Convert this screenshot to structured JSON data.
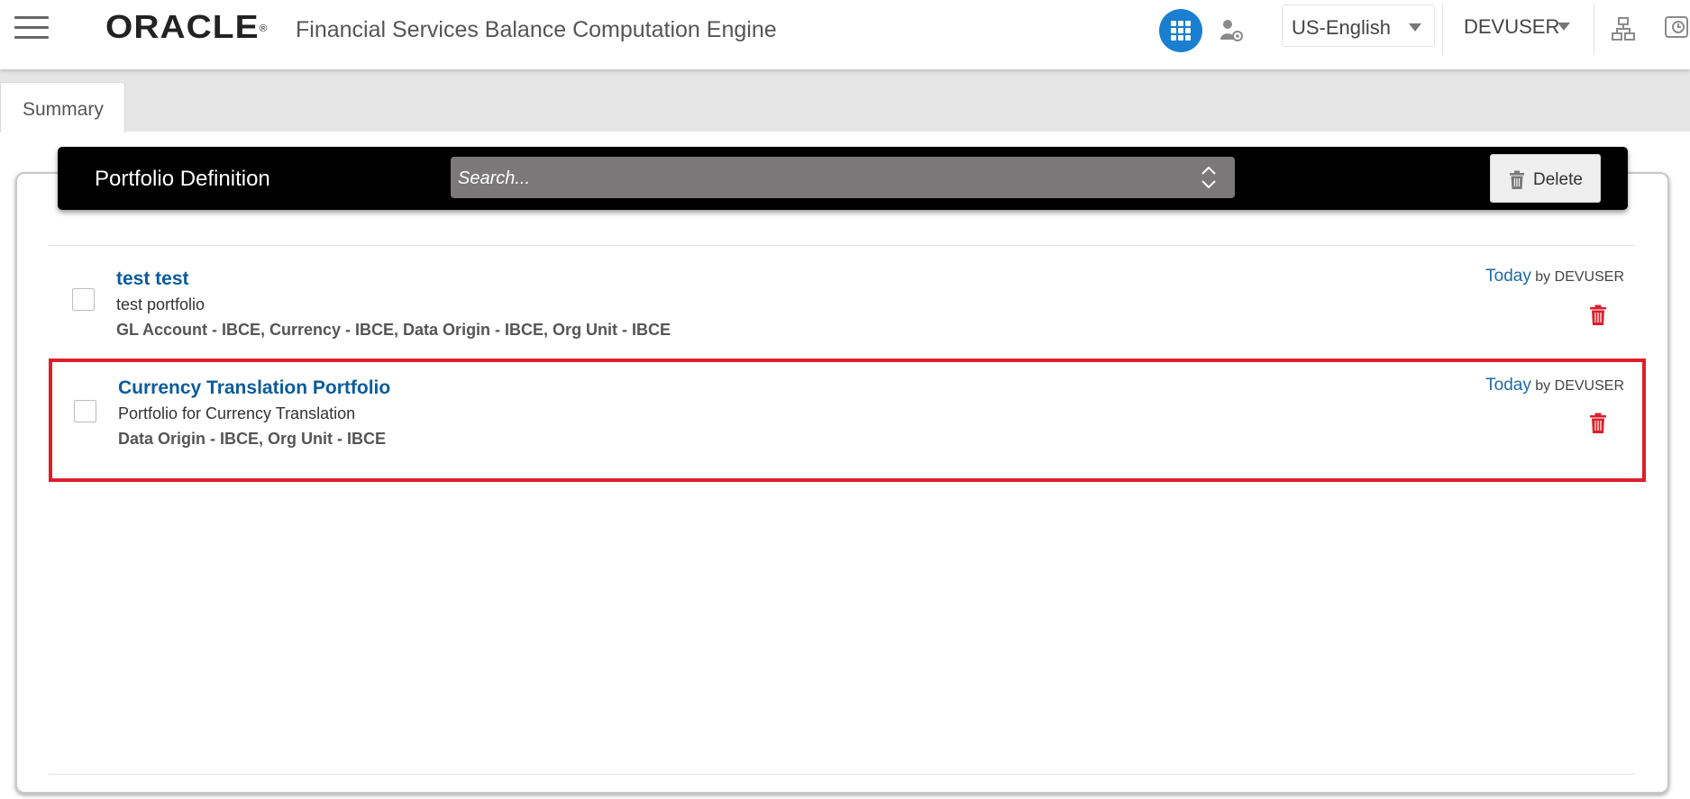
{
  "header": {
    "logo_text": "ORACLE",
    "logo_mark": "®",
    "app_title": "Financial Services Balance Computation Engine",
    "menu_icon": "hamburger-menu-icon",
    "apps_icon": "grid-apps-icon",
    "admin_icon": "user-settings-icon",
    "language": "US-English",
    "user": "DEVUSER",
    "hierarchy_icon": "hierarchy-icon",
    "recent_icon": "clock-icon",
    "accent_color": "#1a7fd0"
  },
  "tabs": [
    {
      "label": "Summary",
      "active": true
    }
  ],
  "toolbar": {
    "title": "Portfolio Definition",
    "search_placeholder": "Search...",
    "delete_label": "Delete"
  },
  "portfolios": [
    {
      "name": "test test",
      "description": "test portfolio",
      "dimensions": "GL Account - IBCE, Currency - IBCE, Data Origin - IBCE, Org Unit - IBCE",
      "modified": "Today",
      "by_label": "by",
      "user": "DEVUSER",
      "highlighted": false
    },
    {
      "name": "Currency Translation Portfolio",
      "description": "Portfolio for Currency Translation",
      "dimensions": "Data Origin - IBCE, Org Unit - IBCE",
      "modified": "Today",
      "by_label": "by",
      "user": "DEVUSER",
      "highlighted": true
    }
  ],
  "colors": {
    "link": "#0a5b9c",
    "delete_red": "#dd1f2b",
    "highlight_border": "#dd1f2b"
  }
}
